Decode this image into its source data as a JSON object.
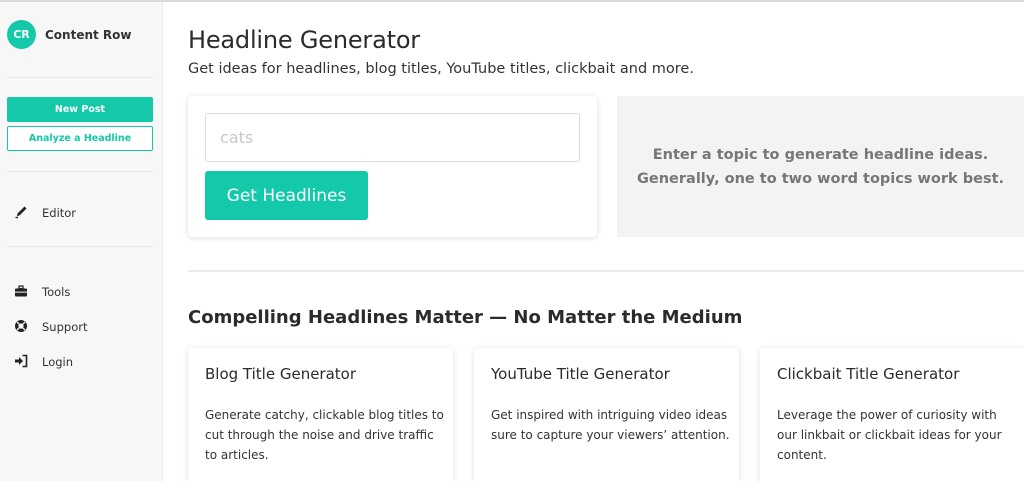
{
  "brand": {
    "initials": "CR",
    "name": "Content Row"
  },
  "sidebar": {
    "new_post": "New Post",
    "analyze": "Analyze a Headline",
    "items": [
      {
        "label": "Editor",
        "icon": "pen-icon"
      },
      {
        "label": "Tools",
        "icon": "toolbox-icon"
      },
      {
        "label": "Support",
        "icon": "lifebuoy-icon"
      },
      {
        "label": "Login",
        "icon": "sign-in-icon"
      }
    ]
  },
  "main": {
    "title": "Headline Generator",
    "subtitle": "Get ideas for headlines, blog titles, YouTube titles, clickbait and more.",
    "input": {
      "placeholder": "cats",
      "value": ""
    },
    "button": "Get Headlines",
    "info": {
      "line1": "Enter a topic to generate headline ideas.",
      "line2": "Generally, one to two word topics work best."
    },
    "section_title": "Compelling Headlines Matter — No Matter the Medium",
    "cards": [
      {
        "title": "Blog Title Generator",
        "desc": "Generate catchy, clickable blog titles to cut through the noise and drive traffic to articles."
      },
      {
        "title": "YouTube Title Generator",
        "desc": "Get inspired with intriguing video ideas sure to capture your viewers’ attention."
      },
      {
        "title": "Clickbait Title Generator",
        "desc": "Leverage the power of curiosity with our linkbait or clickbait ideas for your content."
      }
    ]
  },
  "colors": {
    "accent": "#13c9a9",
    "info_bg": "#f3f3f3",
    "sidebar_bg": "#f7f7f7"
  }
}
